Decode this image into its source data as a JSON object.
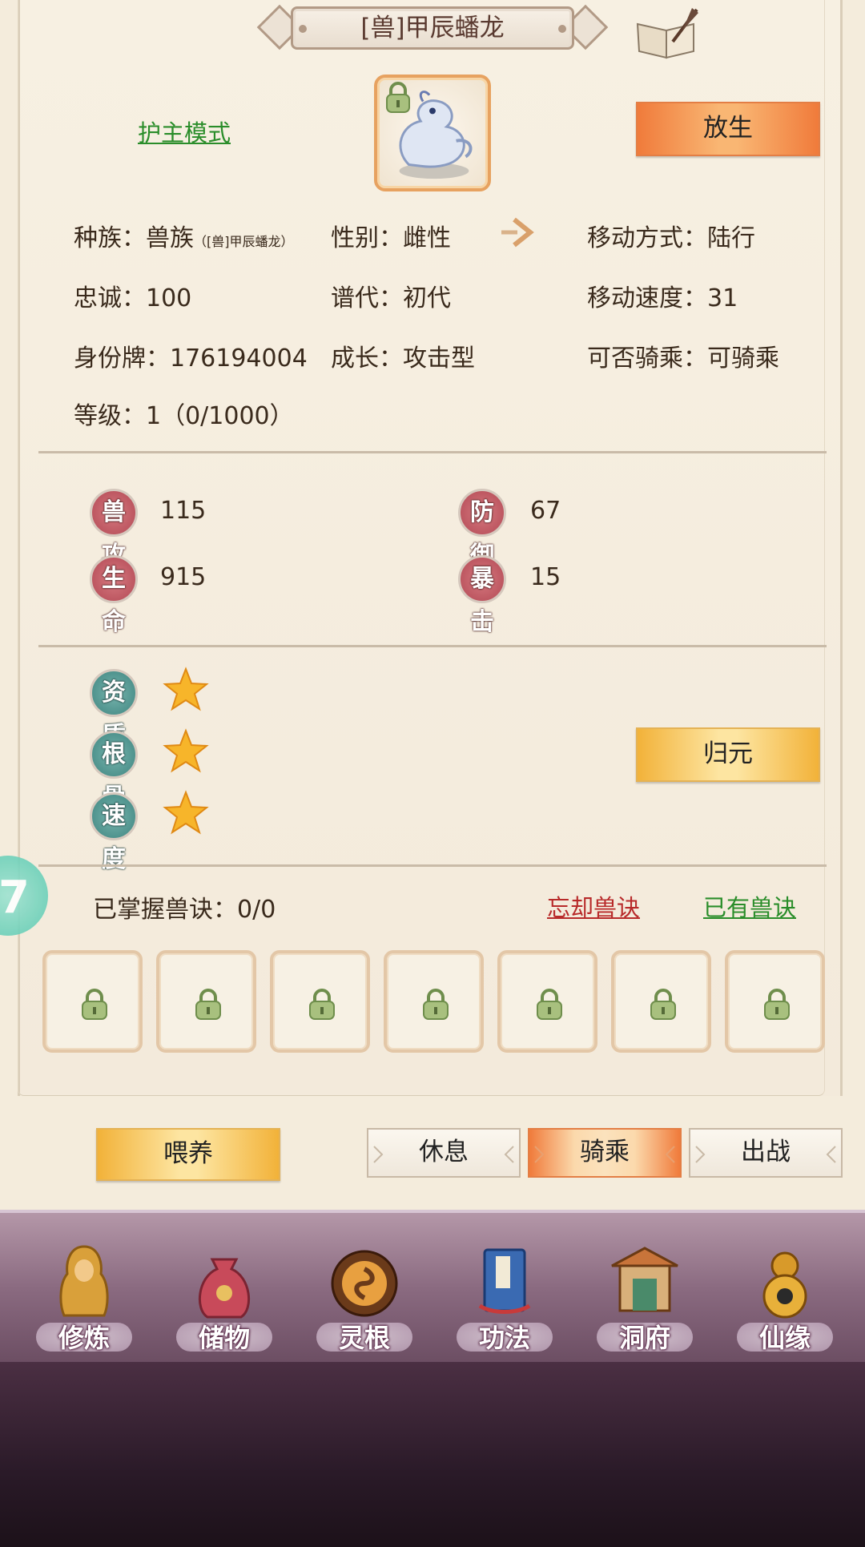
{
  "header": {
    "title": "[兽]甲辰蟠龙"
  },
  "top": {
    "guard_mode": "护主模式",
    "release_button": "放生"
  },
  "info": {
    "race_label": "种族：兽族",
    "race_note": "（[兽]甲辰蟠龙）",
    "gender": "性别：雌性",
    "move_mode": "移动方式：陆行",
    "loyalty": "忠诚：100",
    "generation": "谱代：初代",
    "move_speed": "移动速度：31",
    "id_tag": "身份牌：176194004",
    "growth": "成长：攻击型",
    "rideable": "可否骑乘：可骑乘",
    "level": "等级：1（0/1000）"
  },
  "stats": {
    "attack_label": "兽攻",
    "attack_value": "115",
    "defense_label": "防御",
    "defense_value": "67",
    "hp_label": "生命",
    "hp_value": "915",
    "crit_label": "暴击",
    "crit_value": "15"
  },
  "aptitude": {
    "quality_label": "资质",
    "quality_stars": 1,
    "bone_label": "根骨",
    "bone_stars": 1,
    "speed_label": "速度",
    "speed_stars": 1,
    "reset_button": "归元"
  },
  "skills": {
    "mastered": "已掌握兽诀：0/0",
    "forget_link": "忘却兽诀",
    "owned_link": "已有兽诀",
    "slot_count": 7
  },
  "actions": {
    "feed": "喂养",
    "rest": "休息",
    "ride": "骑乘",
    "battle": "出战",
    "active": "ride"
  },
  "side_bubble": "7",
  "nav": {
    "items": [
      {
        "label": "修炼",
        "icon": "monk-icon"
      },
      {
        "label": "储物",
        "icon": "bag-icon"
      },
      {
        "label": "灵根",
        "icon": "spirit-root-icon"
      },
      {
        "label": "功法",
        "icon": "book-icon"
      },
      {
        "label": "洞府",
        "icon": "cave-house-icon"
      },
      {
        "label": "仙缘",
        "icon": "gourd-icon"
      }
    ]
  },
  "colors": {
    "accent_orange": "#f07b3b",
    "gold": "#f2b239",
    "link_green": "#2a8d2a",
    "link_red": "#b82a2a"
  }
}
